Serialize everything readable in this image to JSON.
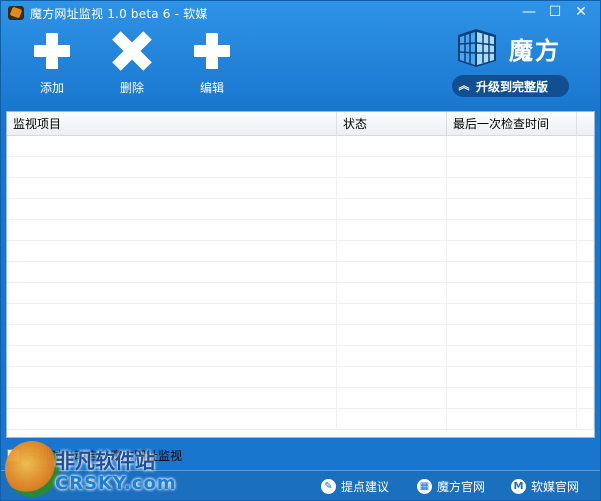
{
  "window": {
    "title": "魔方网址监视 1.0 beta 6 - 软媒"
  },
  "titlebar": {
    "min": "—",
    "max": "☐",
    "close": "✕"
  },
  "toolbar": {
    "add": "添加",
    "delete": "删除",
    "edit": "编辑"
  },
  "brand": {
    "name": "魔方",
    "upgrade": "升级到完整版"
  },
  "grid": {
    "columns": [
      "监视项目",
      "状态",
      "最后一次检查时间",
      ""
    ],
    "rows": 14
  },
  "options": {
    "autostart": "开机时自动启动魔方网址监视"
  },
  "statusbar": {
    "feedback": "提点建议",
    "site": "魔方官网",
    "ruanmei": "软媒官网"
  },
  "watermark": {
    "cn": "非凡软件站",
    "en": "CRSKY.com"
  },
  "colors": {
    "accent": "#1c7fd6",
    "header_dark": "#124f91"
  }
}
